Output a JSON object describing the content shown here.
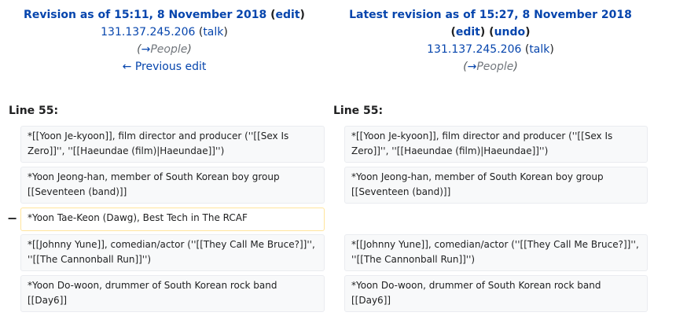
{
  "left_header": {
    "title": "Revision as of 15:11, 8 November 2018",
    "edit": "edit",
    "user": "131.137.245.206",
    "talk": "talk",
    "arrow": "→",
    "section": "People",
    "previous": "← Previous edit"
  },
  "right_header": {
    "title": "Latest revision as of 15:27, 8 November 2018",
    "edit": "edit",
    "undo": "undo",
    "user": "131.137.245.206",
    "talk": "talk",
    "arrow": "→",
    "section": "People"
  },
  "line_labels": {
    "left": "Line 55:",
    "right": "Line 55:"
  },
  "diff_marker": "−",
  "left_lines": [
    "*[[Yoon Je-kyoon]], film director and producer (''[[Sex Is Zero]]'', ''[[Haeundae (film)|Haeundae]]'')",
    "*Yoon Jeong-han, member of South Korean boy group [[Seventeen (band)]]",
    "*Yoon Tae-Keon (Dawg), Best Tech in The RCAF",
    "*[[Johnny Yune]], comedian/actor (''[[They Call Me Bruce?]]'', ''[[The Cannonball Run]]'')",
    "*Yoon Do-woon, drummer of South Korean rock band [[Day6]]"
  ],
  "right_lines": [
    "*[[Yoon Je-kyoon]], film director and producer (''[[Sex Is Zero]]'', ''[[Haeundae (film)|Haeundae]]'')",
    "*Yoon Jeong-han, member of South Korean boy group [[Seventeen (band)]]",
    "*[[Johnny Yune]], comedian/actor (''[[They Call Me Bruce?]]'', ''[[The Cannonball Run]]'')",
    "*Yoon Do-woon, drummer of South Korean rock band [[Day6]]"
  ]
}
